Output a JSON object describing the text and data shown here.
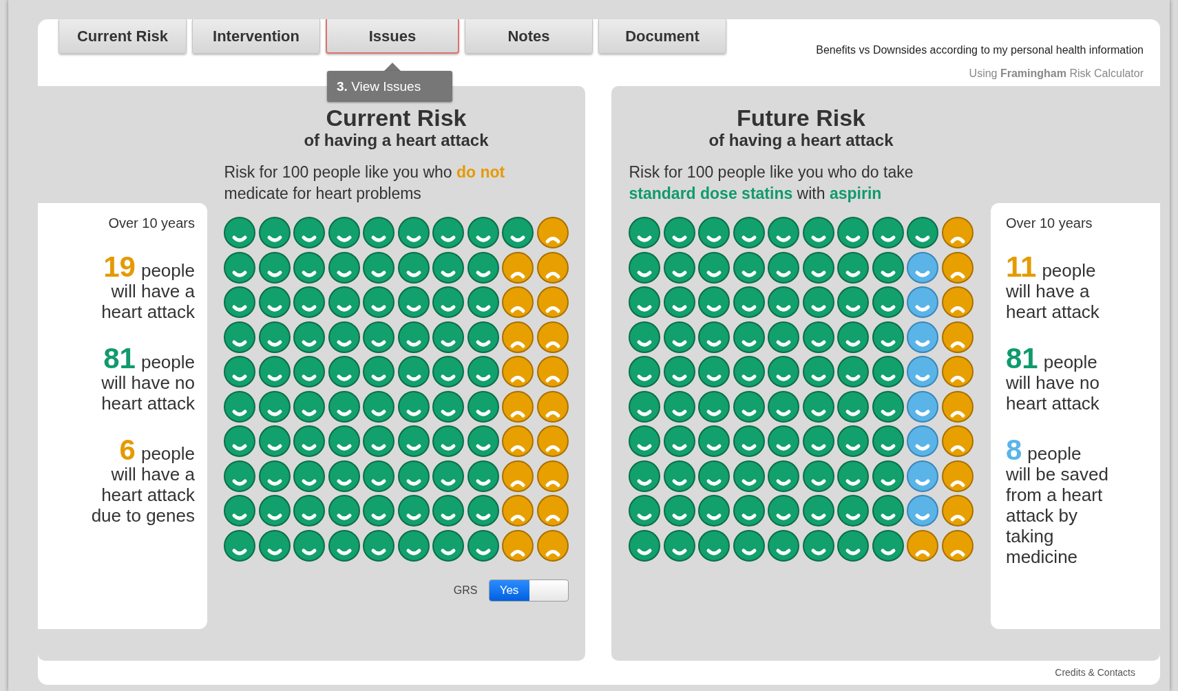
{
  "tabs": [
    {
      "label": "Current Risk",
      "selected": false
    },
    {
      "label": "Intervention",
      "selected": false
    },
    {
      "label": "Issues",
      "selected": true
    },
    {
      "label": "Notes",
      "selected": false
    },
    {
      "label": "Document",
      "selected": false
    }
  ],
  "tooltip": "**3.** View Issues",
  "header": {
    "tagline": "Benefits vs Downsides according to my personal health information",
    "calculator": "Using **Framingham** Risk Calculator"
  },
  "panels": [
    {
      "title": "Current Risk",
      "subtitle": "of having a heart attack",
      "description": "Risk for 100 people like you who **do not** medicate for heart problems",
      "period": "Over 10 years",
      "stats": [
        {
          "number": "19",
          "color": "#e59a00",
          "unit": "people",
          "text": "will have a heart attack"
        },
        {
          "number": "81",
          "color": "#109a6e",
          "unit": "people",
          "text": "will have no heart attack"
        },
        {
          "number": "6",
          "color": "#e59a00",
          "unit": "people",
          "text": "will have a heart attack due to genes"
        }
      ],
      "grid": [
        [
          {
            "kind": "well"
          },
          {
            "kind": "well"
          },
          {
            "kind": "well"
          },
          {
            "kind": "well"
          },
          {
            "kind": "well"
          },
          {
            "kind": "well"
          },
          {
            "kind": "well"
          },
          {
            "kind": "well"
          },
          {
            "kind": "well"
          },
          {
            "kind": "attack"
          }
        ],
        [
          {
            "kind": "well"
          },
          {
            "kind": "well"
          },
          {
            "kind": "well"
          },
          {
            "kind": "well"
          },
          {
            "kind": "well"
          },
          {
            "kind": "well"
          },
          {
            "kind": "well"
          },
          {
            "kind": "well"
          },
          {
            "kind": "attack"
          },
          {
            "kind": "attack"
          }
        ],
        [
          {
            "kind": "well"
          },
          {
            "kind": "well"
          },
          {
            "kind": "well"
          },
          {
            "kind": "well"
          },
          {
            "kind": "well"
          },
          {
            "kind": "well"
          },
          {
            "kind": "well"
          },
          {
            "kind": "well"
          },
          {
            "kind": "attack"
          },
          {
            "kind": "attack"
          }
        ],
        [
          {
            "kind": "well"
          },
          {
            "kind": "well"
          },
          {
            "kind": "well"
          },
          {
            "kind": "well"
          },
          {
            "kind": "well"
          },
          {
            "kind": "well"
          },
          {
            "kind": "well"
          },
          {
            "kind": "well"
          },
          {
            "kind": "attack"
          },
          {
            "kind": "attack"
          }
        ],
        [
          {
            "kind": "well"
          },
          {
            "kind": "well"
          },
          {
            "kind": "well"
          },
          {
            "kind": "well"
          },
          {
            "kind": "well"
          },
          {
            "kind": "well"
          },
          {
            "kind": "well"
          },
          {
            "kind": "well"
          },
          {
            "kind": "attack"
          },
          {
            "kind": "attack"
          }
        ],
        [
          {
            "kind": "well"
          },
          {
            "kind": "well"
          },
          {
            "kind": "well"
          },
          {
            "kind": "well"
          },
          {
            "kind": "well"
          },
          {
            "kind": "well"
          },
          {
            "kind": "well"
          },
          {
            "kind": "well"
          },
          {
            "kind": "attack"
          },
          {
            "kind": "attack"
          }
        ],
        [
          {
            "kind": "well"
          },
          {
            "kind": "well"
          },
          {
            "kind": "well"
          },
          {
            "kind": "well"
          },
          {
            "kind": "well"
          },
          {
            "kind": "well"
          },
          {
            "kind": "well"
          },
          {
            "kind": "well"
          },
          {
            "kind": "attack"
          },
          {
            "kind": "attack"
          }
        ],
        [
          {
            "kind": "well"
          },
          {
            "kind": "well"
          },
          {
            "kind": "well"
          },
          {
            "kind": "well"
          },
          {
            "kind": "well"
          },
          {
            "kind": "well"
          },
          {
            "kind": "well"
          },
          {
            "kind": "well"
          },
          {
            "kind": "attack"
          },
          {
            "kind": "attack"
          }
        ],
        [
          {
            "kind": "well"
          },
          {
            "kind": "well"
          },
          {
            "kind": "well"
          },
          {
            "kind": "well"
          },
          {
            "kind": "well"
          },
          {
            "kind": "well"
          },
          {
            "kind": "well"
          },
          {
            "kind": "well"
          },
          {
            "kind": "attack"
          },
          {
            "kind": "attack"
          }
        ],
        [
          {
            "kind": "well"
          },
          {
            "kind": "well"
          },
          {
            "kind": "well"
          },
          {
            "kind": "well"
          },
          {
            "kind": "well"
          },
          {
            "kind": "well"
          },
          {
            "kind": "well"
          },
          {
            "kind": "well"
          },
          {
            "kind": "attack"
          },
          {
            "kind": "attack"
          }
        ]
      ],
      "toggle": {
        "label": "GRS",
        "value": "Yes",
        "on": true
      }
    },
    {
      "title": "Future Risk",
      "subtitle": "of having a heart attack",
      "description": "Risk for 100 people like you who do take **standard dose statins** with **aspirin**",
      "period": "Over 10 years",
      "stats": [
        {
          "number": "11",
          "color": "#e59a00",
          "unit": "people",
          "text": "will have a heart attack"
        },
        {
          "number": "81",
          "color": "#109a6e",
          "unit": "people",
          "text": "will have no heart attack"
        },
        {
          "number": "8",
          "color": "#5ab4e8",
          "unit": "people",
          "text": "will be saved from a heart attack by taking medicine"
        }
      ],
      "grid": [
        [
          {
            "kind": "well"
          },
          {
            "kind": "well"
          },
          {
            "kind": "well"
          },
          {
            "kind": "well"
          },
          {
            "kind": "well"
          },
          {
            "kind": "well"
          },
          {
            "kind": "well"
          },
          {
            "kind": "well"
          },
          {
            "kind": "well"
          },
          {
            "kind": "attack"
          }
        ],
        [
          {
            "kind": "well"
          },
          {
            "kind": "well"
          },
          {
            "kind": "well"
          },
          {
            "kind": "well"
          },
          {
            "kind": "well"
          },
          {
            "kind": "well"
          },
          {
            "kind": "well"
          },
          {
            "kind": "well"
          },
          {
            "kind": "saved"
          },
          {
            "kind": "attack"
          }
        ],
        [
          {
            "kind": "well"
          },
          {
            "kind": "well"
          },
          {
            "kind": "well"
          },
          {
            "kind": "well"
          },
          {
            "kind": "well"
          },
          {
            "kind": "well"
          },
          {
            "kind": "well"
          },
          {
            "kind": "well"
          },
          {
            "kind": "saved"
          },
          {
            "kind": "attack"
          }
        ],
        [
          {
            "kind": "well"
          },
          {
            "kind": "well"
          },
          {
            "kind": "well"
          },
          {
            "kind": "well"
          },
          {
            "kind": "well"
          },
          {
            "kind": "well"
          },
          {
            "kind": "well"
          },
          {
            "kind": "well"
          },
          {
            "kind": "saved"
          },
          {
            "kind": "attack"
          }
        ],
        [
          {
            "kind": "well"
          },
          {
            "kind": "well"
          },
          {
            "kind": "well"
          },
          {
            "kind": "well"
          },
          {
            "kind": "well"
          },
          {
            "kind": "well"
          },
          {
            "kind": "well"
          },
          {
            "kind": "well"
          },
          {
            "kind": "saved"
          },
          {
            "kind": "attack"
          }
        ],
        [
          {
            "kind": "well"
          },
          {
            "kind": "well"
          },
          {
            "kind": "well"
          },
          {
            "kind": "well"
          },
          {
            "kind": "well"
          },
          {
            "kind": "well"
          },
          {
            "kind": "well"
          },
          {
            "kind": "well"
          },
          {
            "kind": "saved"
          },
          {
            "kind": "attack"
          }
        ],
        [
          {
            "kind": "well"
          },
          {
            "kind": "well"
          },
          {
            "kind": "well"
          },
          {
            "kind": "well"
          },
          {
            "kind": "well"
          },
          {
            "kind": "well"
          },
          {
            "kind": "well"
          },
          {
            "kind": "well"
          },
          {
            "kind": "saved"
          },
          {
            "kind": "attack"
          }
        ],
        [
          {
            "kind": "well"
          },
          {
            "kind": "well"
          },
          {
            "kind": "well"
          },
          {
            "kind": "well"
          },
          {
            "kind": "well"
          },
          {
            "kind": "well"
          },
          {
            "kind": "well"
          },
          {
            "kind": "well"
          },
          {
            "kind": "saved"
          },
          {
            "kind": "attack"
          }
        ],
        [
          {
            "kind": "well"
          },
          {
            "kind": "well"
          },
          {
            "kind": "well"
          },
          {
            "kind": "well"
          },
          {
            "kind": "well"
          },
          {
            "kind": "well"
          },
          {
            "kind": "well"
          },
          {
            "kind": "well"
          },
          {
            "kind": "saved"
          },
          {
            "kind": "attack"
          }
        ],
        [
          {
            "kind": "well"
          },
          {
            "kind": "well"
          },
          {
            "kind": "well"
          },
          {
            "kind": "well"
          },
          {
            "kind": "well"
          },
          {
            "kind": "well"
          },
          {
            "kind": "well"
          },
          {
            "kind": "well"
          },
          {
            "kind": "attack"
          },
          {
            "kind": "attack"
          }
        ]
      ]
    }
  ],
  "footer": {
    "link": "Credits & Contacts"
  }
}
